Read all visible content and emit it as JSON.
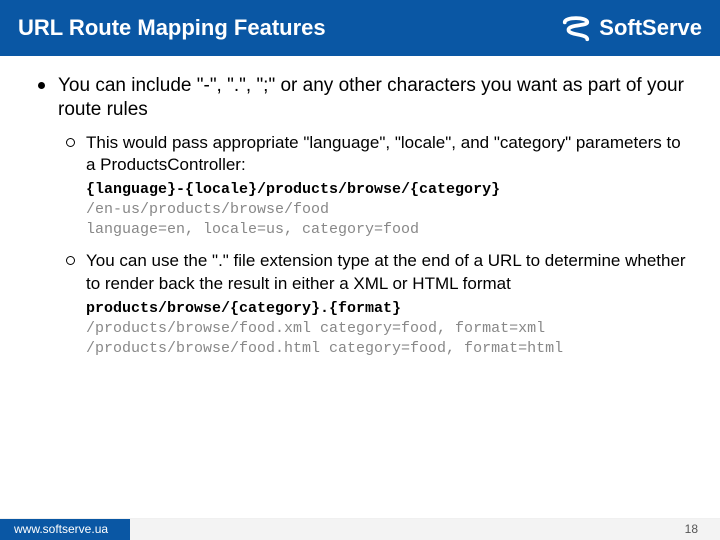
{
  "header": {
    "title": "URL Route Mapping Features",
    "brand": "SoftServe"
  },
  "bullets": {
    "main": "You can include \"-\", \".\", \";\" or any other characters you want as part of your route rules",
    "sub1": {
      "text": "This would pass appropriate \"language\", \"locale\", and \"category\" parameters to a ProductsController:",
      "code_strong": "{language}-{locale}/products/browse/{category}",
      "code_dim1": "/en-us/products/browse/food",
      "code_dim2": "language=en, locale=us, category=food"
    },
    "sub2": {
      "text": "You can use the \".\" file extension type at the end of a URL to determine whether to render back the result in either a XML or HTML format",
      "code_strong": "products/browse/{category}.{format}",
      "code_dim1": "/products/browse/food.xml category=food, format=xml",
      "code_dim2": "/products/browse/food.html category=food, format=html"
    }
  },
  "footer": {
    "url": "www.softserve.ua",
    "page": "18"
  }
}
